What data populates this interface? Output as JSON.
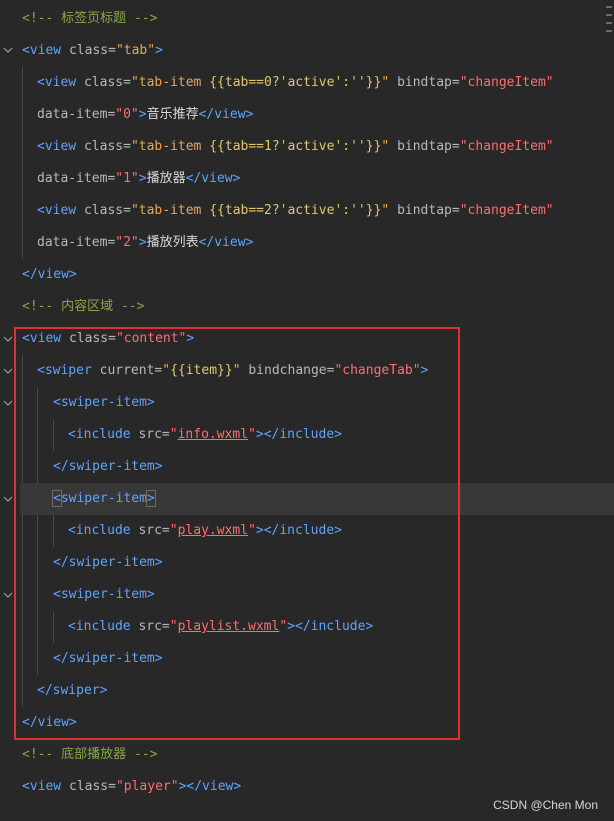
{
  "code": {
    "comment_tab": "<!-- 标签页标题 -->",
    "comment_content": "<!-- 内容区域 -->",
    "comment_player": "<!-- 底部播放器 -->",
    "tab_items": [
      {
        "cond": "{{tab==0?'active':''}}",
        "index": "\"0\"",
        "label": "音乐推荐"
      },
      {
        "cond": "{{tab==1?'active':''}}",
        "index": "\"1\"",
        "label": "播放器"
      },
      {
        "cond": "{{tab==2?'active':''}}",
        "index": "\"2\"",
        "label": "播放列表"
      }
    ],
    "includes": [
      "info.wxml",
      "play.wxml",
      "playlist.wxml"
    ],
    "swiper_current": "{{item}}",
    "swiper_bindchange": "\"changeTab\"",
    "bindtap_value": "\"changeItem\"",
    "class_tab": "\"tab\"",
    "class_content": "\"content\"",
    "class_player": "\"player\""
  },
  "watermark": "CSDN @Chen Mon",
  "colors": {
    "background": "#282828",
    "highlight_border": "#e03131"
  }
}
